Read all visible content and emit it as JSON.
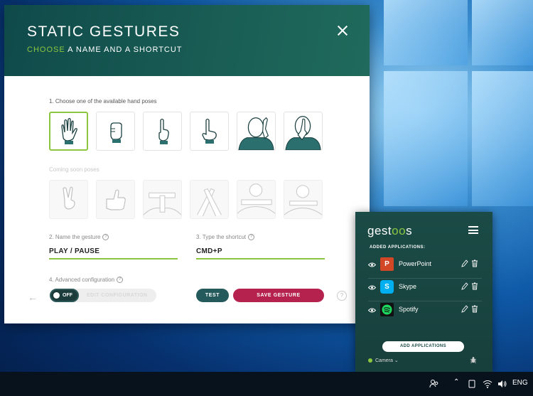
{
  "dialog": {
    "title": "STATIC GESTURES",
    "subtitle_accent": "CHOOSE",
    "subtitle_rest": " A NAME AND A SHORTCUT",
    "step1_label": "1. Choose one of the available hand poses",
    "poses": [
      {
        "icon": "open-palm-hand-icon",
        "selected": true
      },
      {
        "icon": "fist-hand-icon",
        "selected": false
      },
      {
        "icon": "pointing-up-hand-icon",
        "selected": false
      },
      {
        "icon": "l-shape-hand-icon",
        "selected": false
      },
      {
        "icon": "hand-to-ear-person-icon",
        "selected": false
      },
      {
        "icon": "finger-on-lips-person-icon",
        "selected": false
      }
    ],
    "coming_soon_label": "Coming soon poses",
    "coming_soon_poses": [
      "peace-sign-hand-icon",
      "thumbs-up-hand-icon",
      "timeout-gesture-icon",
      "crossed-hands-icon",
      "arms-cross-icon",
      "hands-up-icon"
    ],
    "step2_label": "2. Name the gesture",
    "gesture_name": "PLAY / PAUSE",
    "step3_label": "3. Type the shortcut",
    "shortcut": "CMD+P",
    "step4_label": "4. Advanced configuration",
    "toggle_state": "OFF",
    "edit_config_label": "EDIT CONFIGURATION",
    "test_label": "TEST",
    "save_label": "SAVE GESTURE",
    "help_symbol": "?",
    "accent_color": "#8cc63f",
    "save_color": "#b5224d"
  },
  "panel": {
    "logo_pre": "gest",
    "logo_oo": "oo",
    "logo_post": "s",
    "added_label": "ADDED APPLICATIONS:",
    "apps": [
      {
        "name": "PowerPoint",
        "icon": "powerpoint-icon",
        "letter": "P",
        "color": "#d24726"
      },
      {
        "name": "Skype",
        "icon": "skype-icon",
        "letter": "S",
        "color": "#00aff0"
      },
      {
        "name": "Spotify",
        "icon": "spotify-icon",
        "letter": "",
        "color": "#111111"
      }
    ],
    "add_button": "ADD APPLICATIONS",
    "camera_label": "Camera"
  },
  "taskbar": {
    "language": "ENG"
  }
}
